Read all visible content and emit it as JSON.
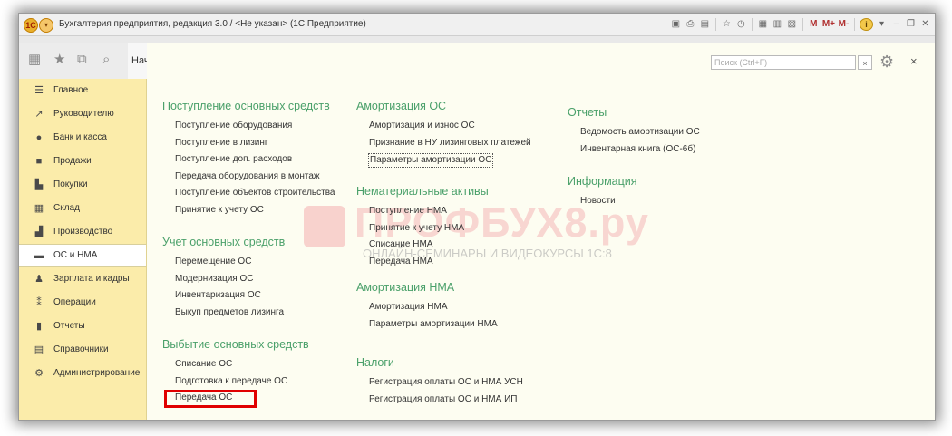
{
  "window": {
    "title": "Бухгалтерия предприятия, редакция 3.0 / <Не указан>  (1С:Предприятие)",
    "logo_text": "1С",
    "toolbar_m_buttons": [
      "M",
      "M+",
      "M-"
    ]
  },
  "home_tab": {
    "label": "Нач"
  },
  "sidebar": {
    "items": [
      {
        "label": "Главное",
        "icon": "list-icon",
        "glyph": "☰"
      },
      {
        "label": "Руководителю",
        "icon": "trend-icon",
        "glyph": "↗"
      },
      {
        "label": "Банк и касса",
        "icon": "coin-icon",
        "glyph": "●"
      },
      {
        "label": "Продажи",
        "icon": "bag-icon",
        "glyph": "■"
      },
      {
        "label": "Покупки",
        "icon": "cart-icon",
        "glyph": "▙"
      },
      {
        "label": "Склад",
        "icon": "warehouse-icon",
        "glyph": "▦"
      },
      {
        "label": "Производство",
        "icon": "factory-icon",
        "glyph": "▟"
      },
      {
        "label": "ОС и НМА",
        "icon": "truck-icon",
        "glyph": "▬",
        "active": true
      },
      {
        "label": "Зарплата и кадры",
        "icon": "person-icon",
        "glyph": "♟"
      },
      {
        "label": "Операции",
        "icon": "operations-icon",
        "glyph": "⁑"
      },
      {
        "label": "Отчеты",
        "icon": "bar-chart-icon",
        "glyph": "▮"
      },
      {
        "label": "Справочники",
        "icon": "book-icon",
        "glyph": "▤"
      },
      {
        "label": "Администрирование",
        "icon": "gear-icon",
        "glyph": "⚙"
      }
    ]
  },
  "search": {
    "placeholder": "Поиск (Ctrl+F)",
    "clear_label": "×"
  },
  "panel_close_label": "×",
  "watermark": {
    "title": "ПРОФБУХ8.ру",
    "subtitle": "ОНЛАЙН-СЕМИНАРЫ И ВИДЕОКУРСЫ 1С:8"
  },
  "columns": [
    {
      "groups": [
        {
          "title": "Поступление основных средств",
          "items": [
            "Поступление оборудования",
            "Поступление в лизинг",
            "Поступление доп. расходов",
            "Передача оборудования в монтаж",
            "Поступление объектов строительства",
            "Принятие к учету ОС"
          ]
        },
        {
          "title": "Учет основных средств",
          "items": [
            "Перемещение ОС",
            "Модернизация ОС",
            "Инвентаризация ОС",
            "Выкуп предметов лизинга"
          ]
        },
        {
          "title": "Выбытие основных средств",
          "items": [
            "Списание ОС",
            "Подготовка к передаче ОС",
            "Передача ОС"
          ]
        }
      ]
    },
    {
      "groups": [
        {
          "title": "Амортизация ОС",
          "items": [
            "Амортизация и износ ОС",
            "Признание в НУ лизинговых платежей",
            "Параметры амортизации ОС"
          ]
        },
        {
          "title": "Нематериальные активы",
          "items": [
            "Поступление НМА",
            "Принятие к учету НМА",
            "Списание НМА",
            "Передача НМА"
          ]
        },
        {
          "title": "Амортизация НМА",
          "items": [
            "Амортизация НМА",
            "Параметры амортизации НМА"
          ]
        },
        {
          "title": "Налоги",
          "items": [
            "Регистрация оплаты ОС и НМА УСН",
            "Регистрация оплаты ОС и НМА ИП"
          ]
        }
      ]
    },
    {
      "groups": [
        {
          "title": "Отчеты",
          "items": [
            "Ведомость амортизации ОС",
            "Инвентарная книга (ОС-6б)"
          ]
        },
        {
          "title": "Информация",
          "items": [
            "Новости"
          ]
        }
      ]
    }
  ]
}
